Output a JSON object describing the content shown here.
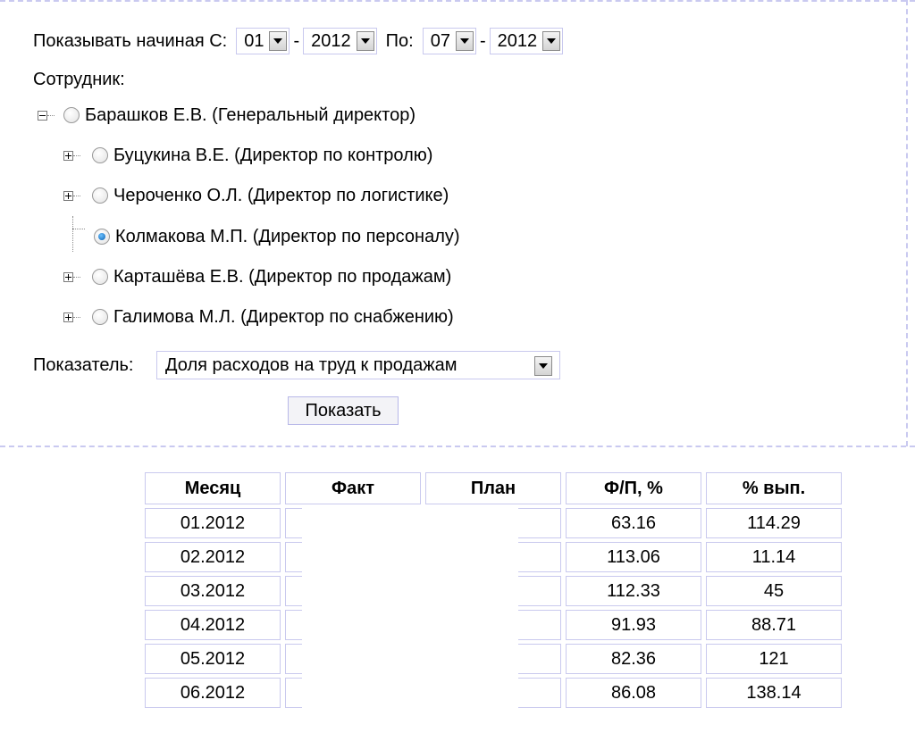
{
  "period": {
    "from_label": "Показывать начиная С:",
    "from_month": "01",
    "from_year": "2012",
    "dash": "-",
    "to_label": "По:",
    "to_month": "07",
    "to_year": "2012"
  },
  "employee_label": "Сотрудник:",
  "employees": [
    {
      "name": "Барашков Е.В. (Генеральный директор)",
      "expander": "minus",
      "selected": false
    },
    {
      "name": "Буцукина В.Е. (Директор по контролю)",
      "expander": "plus",
      "selected": false
    },
    {
      "name": "Чероченко О.Л. (Директор по логистике)",
      "expander": "plus",
      "selected": false
    },
    {
      "name": "Колмакова М.П. (Директор по персоналу)",
      "expander": "none",
      "selected": true
    },
    {
      "name": "Карташёва Е.В. (Директор по продажам)",
      "expander": "plus",
      "selected": false
    },
    {
      "name": "Галимова М.Л. (Директор по снабжению)",
      "expander": "plus",
      "selected": false
    }
  ],
  "indicator": {
    "label": "Показатель:",
    "value": "Доля расходов на труд к продажам"
  },
  "show_button": "Показать",
  "table": {
    "headers": [
      "Месяц",
      "Факт",
      "План",
      "Ф/П, %",
      "% вып."
    ],
    "rows": [
      {
        "month": "01.2012",
        "fp": "63.16",
        "pct": "114.29"
      },
      {
        "month": "02.2012",
        "fp": "113.06",
        "pct": "11.14"
      },
      {
        "month": "03.2012",
        "fp": "112.33",
        "pct": "45"
      },
      {
        "month": "04.2012",
        "fp": "91.93",
        "pct": "88.71"
      },
      {
        "month": "05.2012",
        "fp": "82.36",
        "pct": "121"
      },
      {
        "month": "06.2012",
        "fp": "86.08",
        "pct": "138.14"
      }
    ]
  }
}
